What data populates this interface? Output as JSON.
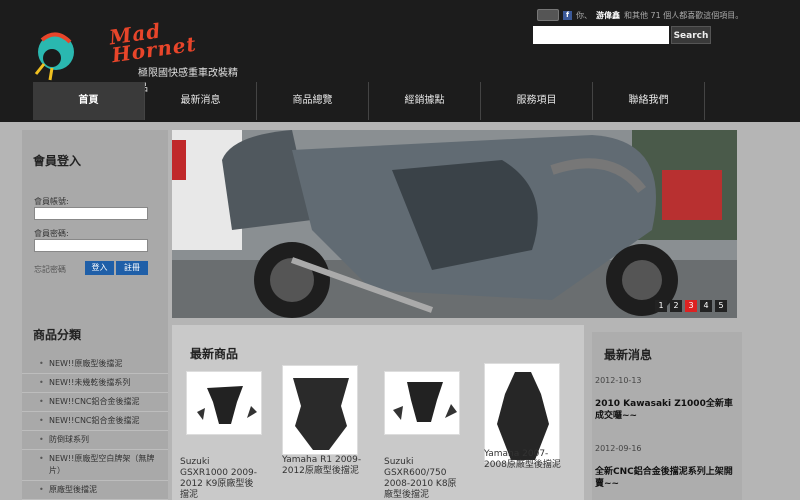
{
  "header": {
    "brand": "Mad Hornet",
    "tagline": "極限國快感重車改裝精品",
    "social_text": "你、",
    "social_name": "游偉鑫",
    "social_rest": "和其他 71 個人都喜歡這個項目。",
    "search_button": "Search"
  },
  "nav": [
    "首頁",
    "最新消息",
    "商品總覽",
    "經銷據點",
    "服務項目",
    "聯絡我們"
  ],
  "login": {
    "title": "會員登入",
    "account_label": "會員帳號:",
    "password_label": "會員密碼:",
    "forgot": "忘記密碼",
    "login_button": "登入",
    "register_button": "註冊"
  },
  "categories": {
    "title": "商品分類",
    "items": [
      "NEW!!原廠型後擋泥",
      "NEW!!未幾乾後擋系列",
      "NEW!!CNC鋁合金後擋泥",
      "NEW!!CNC鋁合金後擋泥",
      "防倒球系列",
      "NEW!!原廠型空白牌架（無牌片）",
      "原廠型後擋泥"
    ]
  },
  "banner": {
    "pages": [
      "1",
      "2",
      "3",
      "4",
      "5"
    ],
    "current_page": "3"
  },
  "products": {
    "title": "最新商品",
    "items": [
      {
        "name": "Suzuki GSXR1000 2009-2012 K9原廠型後擋泥"
      },
      {
        "name": "Yamaha R1 2009-2012原廠型後擋泥"
      },
      {
        "name": "Suzuki GSXR600/750 2008-2010 K8原廠型後擋泥"
      },
      {
        "name": "Yamaha 2007-2008原廠型後擋泥"
      }
    ]
  },
  "news": {
    "title": "最新消息",
    "items": [
      {
        "date": "2012-10-13",
        "title": "2010 Kawasaki Z1000全新車成交囉~~"
      },
      {
        "date": "2012-09-16",
        "title": "全新CNC鋁合金後擋泥系列上架開賣~~"
      }
    ]
  }
}
